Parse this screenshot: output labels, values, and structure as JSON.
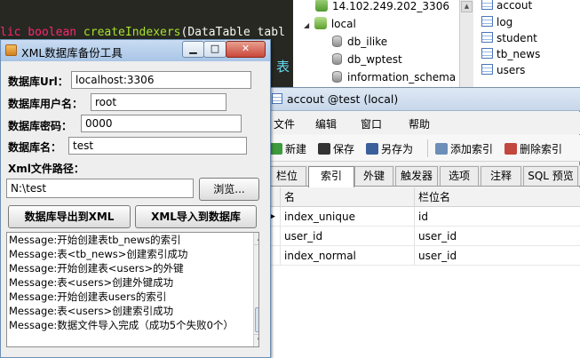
{
  "colors": {
    "code_bg": "#272822",
    "code_keyword": "#f92672",
    "code_func": "#a6e22e",
    "code_text": "#f8f8f2",
    "code_blue": "#66d9ef",
    "close_red": "#c9473b"
  },
  "code_editor": {
    "line1": "lic boolean createIndexers(DataTable tabl",
    "line1_kw": "lic boolean ",
    "line1_fn": "createIndexers",
    "line1_rest": "(DataTable tabl",
    "line2": "表"
  },
  "tree": {
    "server": "14.102.249.202_3306",
    "connection": "local",
    "databases": [
      "db_ilike",
      "db_wptest",
      "information_schema"
    ]
  },
  "table_list": [
    "accout",
    "log",
    "student",
    "tb_news",
    "users"
  ],
  "accout_window": {
    "title": "accout @test (local)",
    "menu": [
      "文件",
      "编辑",
      "窗口",
      "帮助"
    ],
    "toolbar": [
      "新建",
      "保存",
      "另存为",
      "添加索引",
      "删除索引"
    ],
    "tabs": [
      "栏位",
      "索引",
      "外键",
      "触发器",
      "选项",
      "注释",
      "SQL 预览"
    ],
    "active_tab": "索引",
    "columns": [
      "名",
      "栏位名"
    ],
    "rows": [
      {
        "name": "index_unique",
        "field": "id"
      },
      {
        "name": "user_id",
        "field": "user_id"
      },
      {
        "name": "index_normal",
        "field": "user_id"
      }
    ]
  },
  "tool_window": {
    "title": "XML数据库备份工具",
    "url_label": "数据库Url：",
    "url_value": "localhost:3306",
    "user_label": "数据库用户名：",
    "user_value": "root",
    "pwd_label": "数据库密码：",
    "pwd_value": "0000",
    "db_label": "数据库名：",
    "db_value": "test",
    "path_label": "Xml文件路径：",
    "path_value": "N:\\test",
    "browse_label": "浏览...",
    "export_label": "数据库导出到XML",
    "import_label": "XML导入到数据库",
    "log": [
      "Message:开始创建表tb_news的索引",
      "Message:表<tb_news>创建索引成功",
      "Message:开始创建表<users>的外键",
      "Message:表<users>创建外键成功",
      "Message:开始创建表users的索引",
      "Message:表<users>创建索引成功",
      "Message:数据文件导入完成（成功5个失败0个）"
    ]
  }
}
